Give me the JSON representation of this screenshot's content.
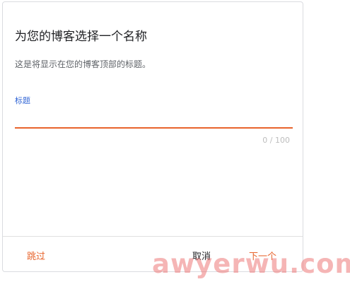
{
  "dialog": {
    "title": "为您的博客选择一个名称",
    "subtitle": "这是将显示在您的博客顶部的标题。",
    "field": {
      "label": "标题",
      "value": "",
      "counter": "0 / 100"
    },
    "buttons": {
      "skip": "跳过",
      "cancel": "取消",
      "next": "下一个"
    }
  },
  "watermark": "awyerwu.com",
  "colors": {
    "accent": "#e8642c",
    "label_blue": "#3367d6",
    "divider": "#e0e0e0"
  }
}
